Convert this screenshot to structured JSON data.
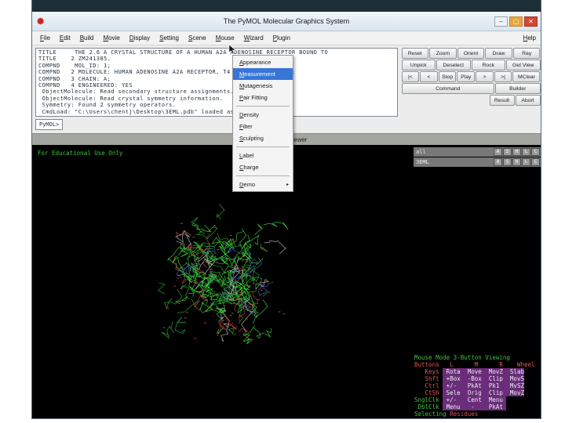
{
  "window": {
    "title": "The PyMOL Molecular Graphics System",
    "icon_glyph": "✺",
    "controls": [
      {
        "name": "minimize",
        "glyph": "–"
      },
      {
        "name": "maximize",
        "glyph": "▢"
      },
      {
        "name": "close",
        "glyph": "✕"
      }
    ]
  },
  "menu_bar": {
    "items": [
      "File",
      "Edit",
      "Build",
      "Movie",
      "Display",
      "Setting",
      "Scene",
      "Mouse",
      "Wizard",
      "Plugin"
    ],
    "right_item": "Help"
  },
  "console": {
    "lines": [
      "TITLE     THE 2.6 A CRYSTAL STRUCTURE OF A HUMAN A2A ADENOSINE RECEPTOR BOUND TO",
      "TITLE    2 ZM241385.",
      "COMPND    MOL_ID: 1;",
      "COMPND   2 MOLECULE: HUMAN ADENOSINE A2A RECEPTOR, T4 LYSOZYME CHIMERA;",
      "COMPND   3 CHAIN: A;",
      "COMPND   4 ENGINEERED: YES",
      " ObjectMolecule: Read secondary structure assignments.",
      " ObjectMolecule: Read crystal symmetry information.",
      " Symmetry: Found 2 symmetry operators.",
      " CmdLoad: \"C:\\Users\\chentj\\Desktop\\3EML.pdb\" loaded as \"3EML\"."
    ],
    "prompt": "PyMOL>"
  },
  "control_panel": {
    "rows": [
      [
        "Reset",
        "Zoom",
        "Orient",
        "Draw",
        "Ray"
      ],
      [
        "Unpick",
        "Deselect",
        "Rock",
        "Get View"
      ],
      [
        "|<",
        "<",
        "Stop",
        "Play",
        ">",
        ">|",
        "MClear"
      ],
      [
        "Command",
        "Builder"
      ],
      [
        "Result",
        "Abort"
      ]
    ]
  },
  "wizard_menu": {
    "items": [
      {
        "label": "Appearance"
      },
      {
        "label": "Measurement",
        "highlighted": true
      },
      {
        "label": "Mutagenesis"
      },
      {
        "label": "Pair Fitting"
      },
      {
        "separator": true
      },
      {
        "label": "Density"
      },
      {
        "label": "Filter"
      },
      {
        "label": "Sculpting"
      },
      {
        "separator": true
      },
      {
        "label": "Label"
      },
      {
        "label": "Charge"
      },
      {
        "separator": true
      },
      {
        "label": "Demo",
        "submenu": true
      }
    ]
  },
  "viewer": {
    "title": "PyMOL Viewer",
    "watermark": "For Educational Use Only",
    "objects": [
      {
        "name": "all",
        "buttons": [
          "A",
          "S",
          "H",
          "L",
          "C"
        ]
      },
      {
        "name": "3EML",
        "buttons": [
          "A",
          "S",
          "H",
          "L",
          "C"
        ]
      }
    ],
    "mouse_panel": [
      [
        {
          "t": "Mouse Mode ",
          "c": "green"
        },
        {
          "t": "3-Button Viewing",
          "c": "green"
        }
      ],
      [
        {
          "t": "Buttons ",
          "c": "red"
        },
        {
          "t": "  L      M      R    Wheel",
          "c": "red"
        }
      ],
      [
        {
          "t": "   Keys ",
          "c": "red"
        },
        {
          "t": " Rota ",
          "c": "cell"
        },
        {
          "t": " Move ",
          "c": "cell"
        },
        {
          "t": " MovZ ",
          "c": "cell"
        },
        {
          "t": " Slab",
          "c": "cell"
        }
      ],
      [
        {
          "t": "   Shft ",
          "c": "red"
        },
        {
          "t": " +Box ",
          "c": "cell"
        },
        {
          "t": " -Box ",
          "c": "cell"
        },
        {
          "t": " Clip ",
          "c": "cell"
        },
        {
          "t": " MovS",
          "c": "cell"
        }
      ],
      [
        {
          "t": "   Ctrl ",
          "c": "red"
        },
        {
          "t": " +/-  ",
          "c": "cell"
        },
        {
          "t": " PkAt ",
          "c": "cell"
        },
        {
          "t": " Pk1  ",
          "c": "cell"
        },
        {
          "t": " MvSZ",
          "c": "cell"
        }
      ],
      [
        {
          "t": "   CtSh ",
          "c": "red"
        },
        {
          "t": " Sele ",
          "c": "cell"
        },
        {
          "t": " Orig ",
          "c": "cell"
        },
        {
          "t": " Clip ",
          "c": "cell"
        },
        {
          "t": " MovZ",
          "c": "cell"
        }
      ],
      [
        {
          "t": "SnglClk ",
          "c": "green"
        },
        {
          "t": " +/-  ",
          "c": "cell"
        },
        {
          "t": " Cent ",
          "c": "cell"
        },
        {
          "t": " Menu ",
          "c": "cell"
        }
      ],
      [
        {
          "t": " DblClk ",
          "c": "green"
        },
        {
          "t": " Menu ",
          "c": "cell"
        },
        {
          "t": "  -   ",
          "c": "cell"
        },
        {
          "t": " PkAt ",
          "c": "cell"
        }
      ],
      [
        {
          "t": "Selecting ",
          "c": "green"
        },
        {
          "t": "Residues",
          "c": "red"
        }
      ]
    ]
  },
  "colors": {
    "menu_highlight": "#3875d7",
    "close_button": "#d14836",
    "viewer_green": "#3ec43e",
    "panel_red": "#e05555",
    "cell_bg": "#6a2d7a",
    "molecule_green": "#2fae2f"
  }
}
